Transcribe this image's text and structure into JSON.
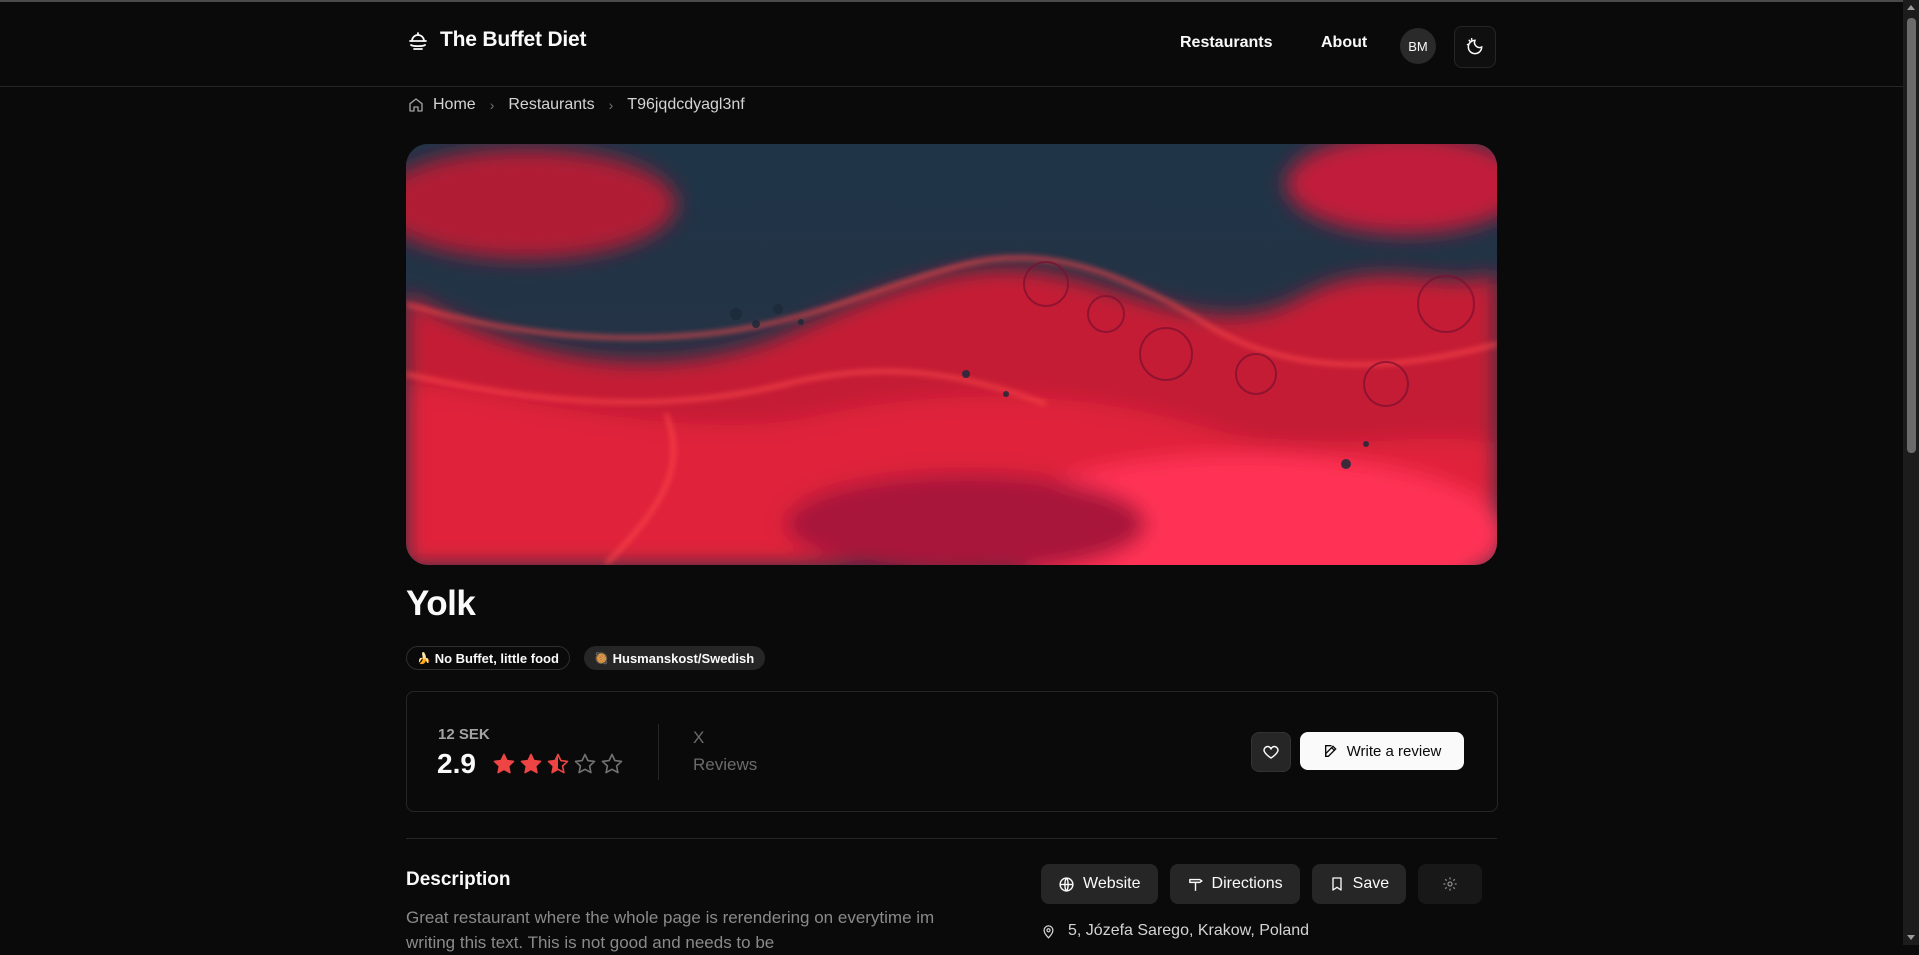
{
  "header": {
    "brand": "The Buffet Diet",
    "nav": {
      "restaurants": "Restaurants",
      "about": "About"
    },
    "avatar": "BM",
    "theme_toggle_icon": "moon-sun-icon"
  },
  "breadcrumb": {
    "home": "Home",
    "restaurants": "Restaurants",
    "current": "T96jqdcdyagl3nf"
  },
  "hero": {
    "description": "abstract red and teal fluid art",
    "colors": [
      "#1f3447",
      "#e0233a",
      "#ff3050",
      "#a8183a"
    ]
  },
  "restaurant": {
    "name": "Yolk",
    "tags": [
      {
        "emoji": "🍌",
        "label": "No Buffet, little food"
      },
      {
        "emoji": "🥘",
        "label": "Husmanskost/Swedish"
      }
    ]
  },
  "rating_card": {
    "price": "12 SEK",
    "score": "2.9",
    "stars_filled": 2.5,
    "stars_total": 5,
    "review_count": "X",
    "review_label": "Reviews",
    "write_review_label": "Write a review",
    "star_color": "#ef4444"
  },
  "description": {
    "heading": "Description",
    "text": "Great restaurant where the whole page is rerendering on everytime im writing this text. This is not good and needs to be"
  },
  "actions": {
    "website": "Website",
    "directions": "Directions",
    "save": "Save"
  },
  "address": "5, Józefa Sarego, Krakow, Poland"
}
